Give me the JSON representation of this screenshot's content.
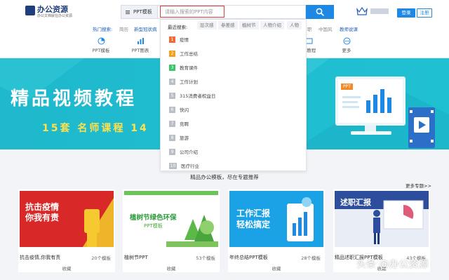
{
  "header": {
    "logo_title": "办公资源",
    "logo_sub": "办公文档就在办公资源",
    "search_type": "PPT模板",
    "search_placeholder": "请输入搜索的PPT内容",
    "login_label": "登录",
    "register_label": "注册"
  },
  "hot": {
    "label": "热门搜索:",
    "items": [
      "简历",
      "新型冠状病",
      "职",
      "中国风",
      "教师说课"
    ]
  },
  "nav": {
    "items": [
      {
        "label": "PPT模板",
        "icon": "ppt-template-icon"
      },
      {
        "label": "PPT图表",
        "icon": "ppt-chart-icon"
      },
      {
        "label": "ce教程",
        "icon": "tutorial-icon"
      },
      {
        "label": "更多",
        "icon": "more-icon"
      }
    ]
  },
  "dropdown": {
    "recent_label": "最近搜索:",
    "recent_tags": [
      "层次感",
      "参差感",
      "植树节",
      "人物介绍",
      "人物"
    ],
    "items": [
      {
        "num": "1",
        "text": "疫情"
      },
      {
        "num": "2",
        "text": "工作总结"
      },
      {
        "num": "3",
        "text": "教育课件"
      },
      {
        "num": "4",
        "text": "工作计划"
      },
      {
        "num": "5",
        "text": "315消费者权益日"
      },
      {
        "num": "6",
        "text": "快闪"
      },
      {
        "num": "7",
        "text": "竞聘"
      },
      {
        "num": "8",
        "text": "旅游"
      },
      {
        "num": "9",
        "text": "公司介绍"
      },
      {
        "num": "10",
        "text": "医疗行业"
      }
    ],
    "num_colors": [
      "#f06a35",
      "#f2a11f",
      "#3cc46a",
      "#b9bec7"
    ]
  },
  "banner": {
    "title": "精品视频教程",
    "subtitle": "15套 名师课程  14",
    "ppt_tag": "PPT"
  },
  "section": {
    "title": "精品办公模板，尽在专题推荐",
    "more": "更多专题>>"
  },
  "cards": [
    {
      "name": "抗击疫情,你我有责",
      "count": "20个模板",
      "fav": "收藏",
      "img_text1": "抗击疫情",
      "img_text2": "你我有责"
    },
    {
      "name": "植树节PPT",
      "count": "53个模板",
      "fav": "收藏",
      "img_text1": "植树节绿色环保",
      "img_text2": "PPT模板"
    },
    {
      "name": "年终总结PPT模板",
      "count": "28个模板",
      "fav": "收藏",
      "img_text1": "工作汇报",
      "img_text2": "轻松搞定"
    },
    {
      "name": "精品述职汇报PPT模板",
      "count": "43个模板",
      "fav": "收藏",
      "img_text1": "述职汇报",
      "img_text2": ""
    }
  ],
  "watermark": "头条 @办公资源",
  "colors": {
    "accent": "#1e88e5",
    "banner": "#1fb8cc",
    "highlight": "#e23b3b"
  }
}
